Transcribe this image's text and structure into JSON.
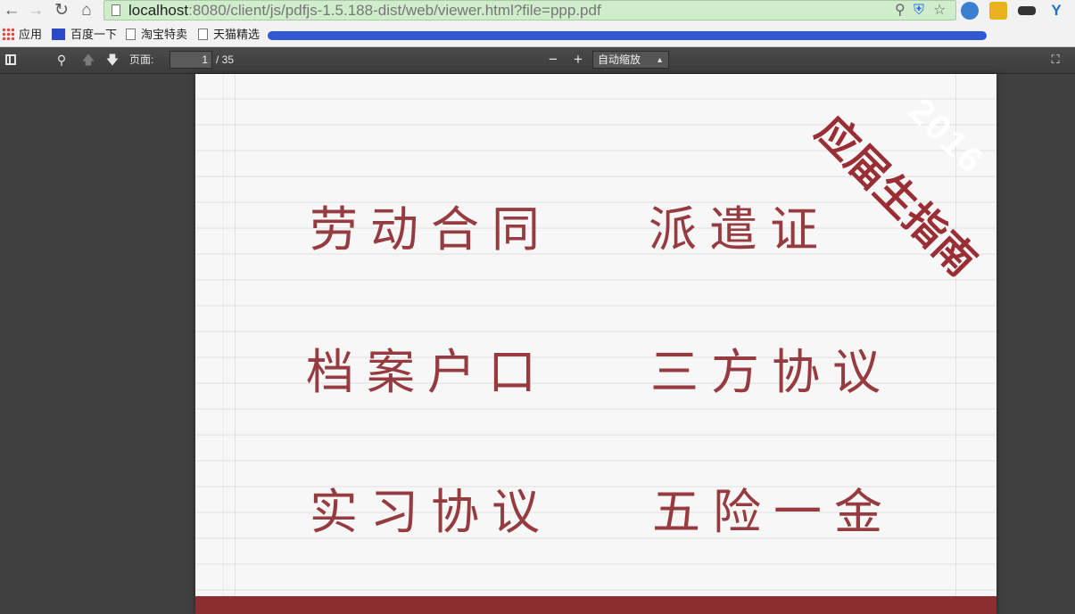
{
  "browser": {
    "url_host": "localhost",
    "url_rest": ":8080/client/js/pdfjs-1.5.188-dist/web/viewer.html?file=ppp.pdf",
    "bookmarks": [
      {
        "label": "应用",
        "icon": "apps-grid-icon"
      },
      {
        "label": "百度一下",
        "icon": "baidu-paw-icon"
      },
      {
        "label": "淘宝特卖",
        "icon": "page-icon"
      },
      {
        "label": "天猫精选",
        "icon": "page-icon"
      }
    ]
  },
  "toolbar": {
    "page_label": "页面:",
    "page_value": "1",
    "page_total": "/ 35",
    "zoom_value": "自动缩放"
  },
  "document": {
    "ribbon_year": "2016",
    "ribbon_title": "应届生指南",
    "items": [
      "劳动合同",
      "派遣证",
      "档案户口",
      "三方协议",
      "实习协议",
      "五险一金"
    ]
  },
  "colors": {
    "accent": "#963b40",
    "band": "#8c2d32"
  }
}
